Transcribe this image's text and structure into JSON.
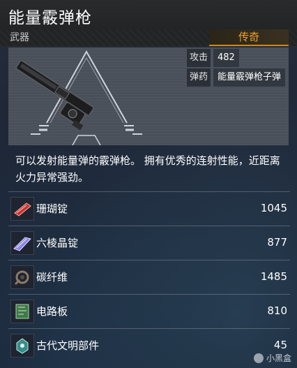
{
  "item": {
    "title": "能量霰弹枪",
    "category": "武器",
    "rarity": "传奇",
    "rarity_color": "#f0a528"
  },
  "stats": [
    {
      "key": "攻击",
      "value": "482"
    },
    {
      "key": "弹药",
      "value": "能量霰弹枪子弹"
    }
  ],
  "description": "可以发射能量弹的霰弹枪。 拥有优秀的连射性能，近距离火力异常强劲。",
  "materials": [
    {
      "name": "珊瑚锭",
      "qty": "1045",
      "icon": "coral-ingot-icon"
    },
    {
      "name": "六棱晶锭",
      "qty": "877",
      "icon": "hexagonal-crystal-ingot-icon"
    },
    {
      "name": "碳纤维",
      "qty": "1485",
      "icon": "carbon-fiber-icon"
    },
    {
      "name": "电路板",
      "qty": "810",
      "icon": "circuit-board-icon"
    },
    {
      "name": "古代文明部件",
      "qty": "45",
      "icon": "ancient-civilization-part-icon"
    }
  ],
  "watermark": "小黑盒"
}
